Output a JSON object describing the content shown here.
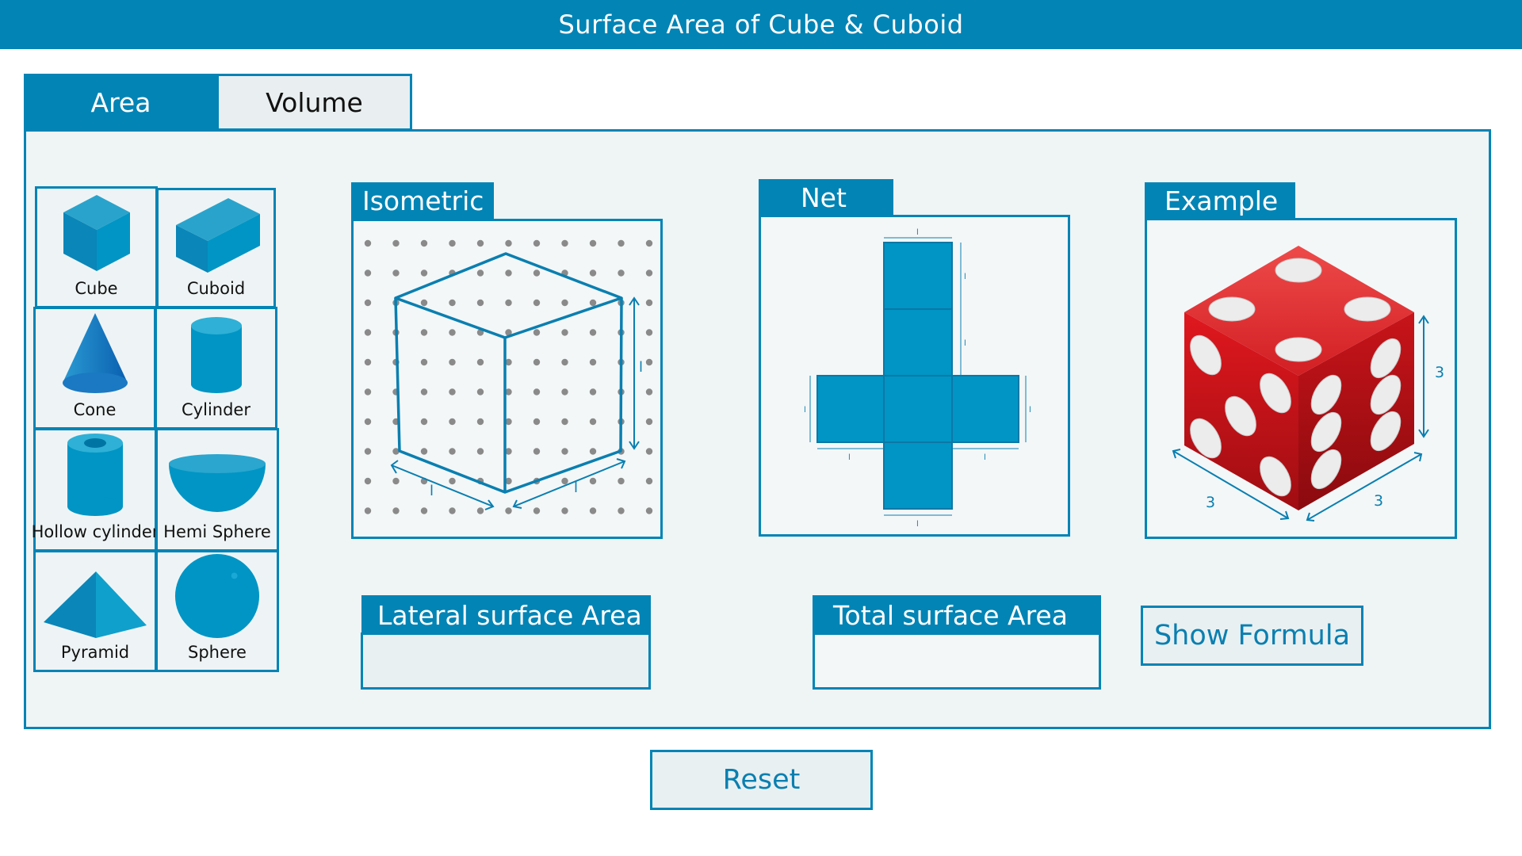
{
  "header": {
    "title": "Surface Area of Cube & Cuboid"
  },
  "tabs": [
    {
      "label": "Area",
      "active": true
    },
    {
      "label": "Volume",
      "active": false
    }
  ],
  "shapes": [
    {
      "label": "Cube",
      "icon": "cube-icon"
    },
    {
      "label": "Cuboid",
      "icon": "cuboid-icon"
    },
    {
      "label": "Cone",
      "icon": "cone-icon"
    },
    {
      "label": "Cylinder",
      "icon": "cylinder-icon"
    },
    {
      "label": "Hollow cylinder",
      "icon": "hollow-cylinder-icon"
    },
    {
      "label": "Hemi Sphere",
      "icon": "hemisphere-icon"
    },
    {
      "label": "Pyramid",
      "icon": "pyramid-icon"
    },
    {
      "label": "Sphere",
      "icon": "sphere-icon"
    }
  ],
  "sections": {
    "isometric": {
      "label": "Isometric",
      "edge_label": "l"
    },
    "net": {
      "label": "Net",
      "edge_label": "l"
    },
    "example": {
      "label": "Example",
      "dim_height": "3",
      "dim_left": "3",
      "dim_right": "3"
    }
  },
  "results": {
    "lateral_label": "Lateral surface Area",
    "lateral_value": "",
    "total_label": "Total surface Area",
    "total_value": ""
  },
  "buttons": {
    "show_formula": "Show Formula",
    "reset": "Reset"
  },
  "colors": {
    "primary": "#0284b5",
    "panel_bg": "#eff4f5",
    "dice_red": "#d4161c"
  }
}
